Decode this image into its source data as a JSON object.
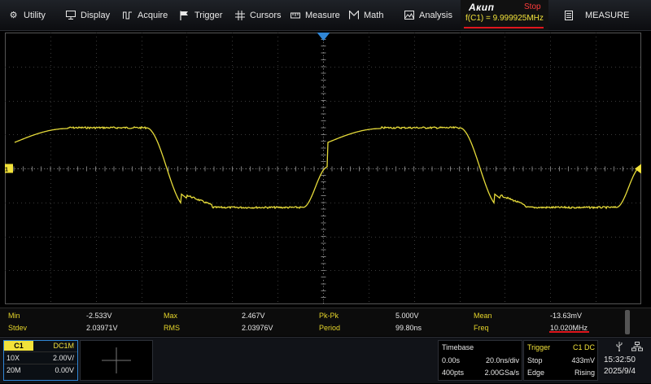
{
  "menu": {
    "utility": "Utility",
    "display": "Display",
    "acquire": "Acquire",
    "trigger": "Trigger",
    "cursors": "Cursors",
    "measure": "Measure",
    "math": "Math",
    "analysis": "Analysis",
    "measure_panel": "MEASURE"
  },
  "brand": {
    "logo": "Акип",
    "run_state": "Stop",
    "freq_readout": "f(C1) = 9.999925MHz"
  },
  "screen": {
    "channel_marker": "C1",
    "trigger_position_marker_color": "#2f86d6",
    "waveform_color": "#e7dc3a"
  },
  "measurements": {
    "row1": [
      {
        "label": "Min",
        "value": "-2.533V"
      },
      {
        "label": "Max",
        "value": "2.467V"
      },
      {
        "label": "Pk-Pk",
        "value": "5.000V"
      },
      {
        "label": "Mean",
        "value": "-13.63mV"
      }
    ],
    "row2": [
      {
        "label": "Stdev",
        "value": "2.03971V"
      },
      {
        "label": "RMS",
        "value": "2.03976V"
      },
      {
        "label": "Period",
        "value": "99.80ns"
      },
      {
        "label": "Freq",
        "value": "10.020MHz"
      }
    ]
  },
  "channel": {
    "name": "C1",
    "coupling": "DC1M",
    "probe": "10X",
    "scale": "2.00V/",
    "bw": "20M",
    "offset": "0.00V"
  },
  "timebase": {
    "title": "Timebase",
    "delay": "0.00s",
    "scale": "20.0ns/div",
    "points": "400pts",
    "rate": "2.00GSa/s"
  },
  "trigger": {
    "title": "Trigger",
    "source": "C1 DC",
    "mode": "Stop",
    "level": "433mV",
    "type": "Edge",
    "slope": "Rising"
  },
  "clock": {
    "time": "15:32:50",
    "date": "2025/9/4"
  }
}
